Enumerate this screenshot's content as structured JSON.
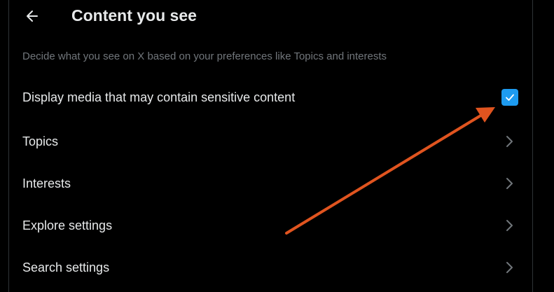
{
  "header": {
    "title": "Content you see",
    "back_icon": "arrow-left-icon"
  },
  "subtitle": "Decide what you see on X based on your preferences like Topics and interests",
  "rows": [
    {
      "label": "Display media that may contain sensitive content",
      "control": "checkbox",
      "checked": true
    },
    {
      "label": "Topics",
      "control": "chevron-right-icon"
    },
    {
      "label": "Interests",
      "control": "chevron-right-icon"
    },
    {
      "label": "Explore settings",
      "control": "chevron-right-icon"
    },
    {
      "label": "Search settings",
      "control": "chevron-right-icon"
    }
  ],
  "colors": {
    "background": "#000000",
    "text": "#e7e9ea",
    "muted": "#71767b",
    "accent": "#1d9bf0",
    "annotation_arrow": "#e0541f"
  }
}
